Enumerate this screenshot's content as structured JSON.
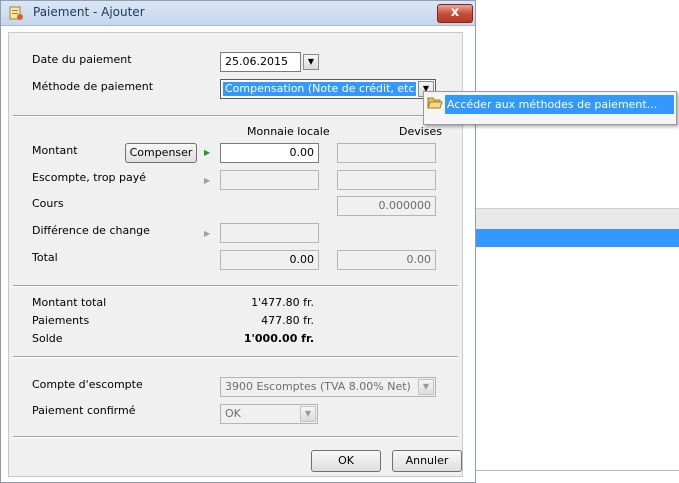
{
  "window": {
    "title": "Paiement - Ajouter",
    "close_label": "x"
  },
  "payment": {
    "date_label": "Date du paiement",
    "date_value": "25.06.2015",
    "method_label": "Méthode de paiement",
    "method_value": "Compensation (Note de crédit, etc.)"
  },
  "popup": {
    "item_label": "Accéder aux méthodes de paiement..."
  },
  "amounts": {
    "col_local": "Monnaie locale",
    "col_currency": "Devises",
    "montant_label": "Montant",
    "compenser_label": "Compenser",
    "montant_local": "0.00",
    "montant_currency": "",
    "escompte_label": "Escompte, trop payé",
    "escompte_local": "",
    "escompte_currency": "",
    "cours_label": "Cours",
    "cours_value": "0.000000",
    "difference_label": "Différence de change",
    "difference_local": "",
    "total_label": "Total",
    "total_local": "0.00",
    "total_currency": "0.00"
  },
  "summary": {
    "montant_total_label": "Montant total",
    "montant_total_value": "1'477.80 fr.",
    "paiements_label": "Paiements",
    "paiements_value": "477.80 fr.",
    "solde_label": "Solde",
    "solde_value": "1'000.00 fr."
  },
  "options": {
    "compte_label": "Compte d'escompte",
    "compte_value": "3900 Escomptes (TVA 8.00% Net)",
    "confirme_label": "Paiement confirmé",
    "confirme_value": "OK"
  },
  "buttons": {
    "ok_label": "OK",
    "cancel_label": "Annuler"
  },
  "icons": {
    "dropdown_arrow": "▼",
    "row_arrow": "▶"
  },
  "colors": {
    "selection": "#3399ff",
    "active_arrow": "#1b9b2a"
  }
}
